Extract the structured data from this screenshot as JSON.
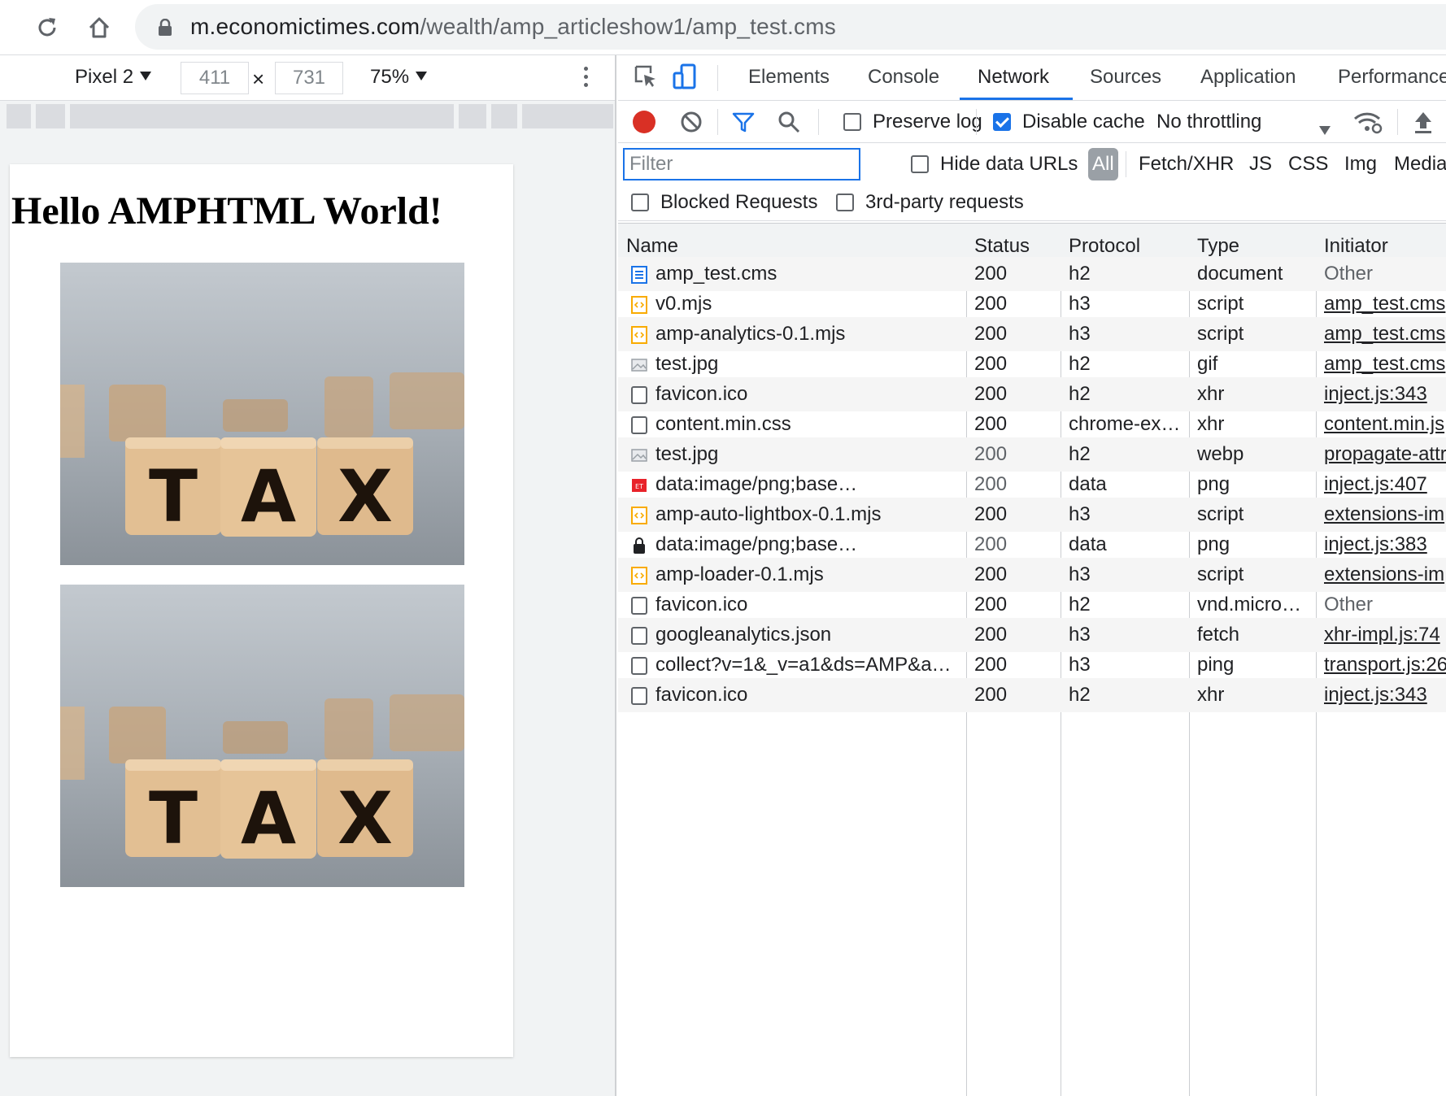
{
  "browser": {
    "url_host": "m.economictimes.com",
    "url_path": "/wealth/amp_articleshow1/amp_test.cms",
    "icons": [
      "reload-icon",
      "home-icon",
      "lock-icon"
    ]
  },
  "device_toolbar": {
    "device": "Pixel 2",
    "width": "411",
    "height": "731",
    "times": "×",
    "zoom": "75%"
  },
  "page": {
    "heading": "Hello AMPHTML World!",
    "image_letters": [
      "T",
      "A",
      "X"
    ]
  },
  "devtools": {
    "tabs": [
      "Elements",
      "Console",
      "Network",
      "Sources",
      "Application",
      "Performance"
    ],
    "active_tab": "Network",
    "toolbar": {
      "preserve_log": "Preserve log",
      "preserve_log_checked": false,
      "disable_cache": "Disable cache",
      "disable_cache_checked": true,
      "throttling": "No throttling"
    },
    "filter": {
      "placeholder": "Filter",
      "hide_data_urls": "Hide data URLs",
      "types": [
        "All",
        "Fetch/XHR",
        "JS",
        "CSS",
        "Img",
        "Media"
      ],
      "blocked_requests": "Blocked Requests",
      "third_party": "3rd-party requests"
    },
    "columns": [
      "Name",
      "Status",
      "Protocol",
      "Type",
      "Initiator"
    ],
    "rows": [
      {
        "icon": "document",
        "name": "amp_test.cms",
        "status": "200",
        "protocol": "h2",
        "type": "document",
        "initiator": "Other",
        "initiator_link": false,
        "status_dim": false
      },
      {
        "icon": "script",
        "name": "v0.mjs",
        "status": "200",
        "protocol": "h3",
        "type": "script",
        "initiator": "amp_test.cms",
        "initiator_link": true,
        "status_dim": false
      },
      {
        "icon": "script",
        "name": "amp-analytics-0.1.mjs",
        "status": "200",
        "protocol": "h3",
        "type": "script",
        "initiator": "amp_test.cms",
        "initiator_link": true,
        "status_dim": false
      },
      {
        "icon": "image",
        "name": "test.jpg",
        "status": "200",
        "protocol": "h2",
        "type": "gif",
        "initiator": "amp_test.cms",
        "initiator_link": true,
        "status_dim": false
      },
      {
        "icon": "blank",
        "name": "favicon.ico",
        "status": "200",
        "protocol": "h2",
        "type": "xhr",
        "initiator": "inject.js:343",
        "initiator_link": true,
        "status_dim": false
      },
      {
        "icon": "blank",
        "name": "content.min.css",
        "status": "200",
        "protocol": "chrome-ex…",
        "type": "xhr",
        "initiator": "content.min.js",
        "initiator_link": true,
        "status_dim": false
      },
      {
        "icon": "image",
        "name": "test.jpg",
        "status": "200",
        "protocol": "h2",
        "type": "webp",
        "initiator": "propagate-attr",
        "initiator_link": true,
        "status_dim": true
      },
      {
        "icon": "et-logo",
        "name": "data:image/png;base…",
        "status": "200",
        "protocol": "data",
        "type": "png",
        "initiator": "inject.js:407",
        "initiator_link": true,
        "status_dim": true
      },
      {
        "icon": "script",
        "name": "amp-auto-lightbox-0.1.mjs",
        "status": "200",
        "protocol": "h3",
        "type": "script",
        "initiator": "extensions-im",
        "initiator_link": true,
        "status_dim": false
      },
      {
        "icon": "lock",
        "name": "data:image/png;base…",
        "status": "200",
        "protocol": "data",
        "type": "png",
        "initiator": "inject.js:383",
        "initiator_link": true,
        "status_dim": true
      },
      {
        "icon": "script",
        "name": "amp-loader-0.1.mjs",
        "status": "200",
        "protocol": "h3",
        "type": "script",
        "initiator": "extensions-im",
        "initiator_link": true,
        "status_dim": false
      },
      {
        "icon": "blank",
        "name": "favicon.ico",
        "status": "200",
        "protocol": "h2",
        "type": "vnd.micro…",
        "initiator": "Other",
        "initiator_link": false,
        "status_dim": false
      },
      {
        "icon": "blank",
        "name": "googleanalytics.json",
        "status": "200",
        "protocol": "h3",
        "type": "fetch",
        "initiator": "xhr-impl.js:74",
        "initiator_link": true,
        "status_dim": false
      },
      {
        "icon": "blank",
        "name": "collect?v=1&_v=a1&ds=AMP&a…",
        "status": "200",
        "protocol": "h3",
        "type": "ping",
        "initiator": "transport.js:26",
        "initiator_link": true,
        "status_dim": false
      },
      {
        "icon": "blank",
        "name": "favicon.ico",
        "status": "200",
        "protocol": "h2",
        "type": "xhr",
        "initiator": "inject.js:343",
        "initiator_link": true,
        "status_dim": false
      }
    ]
  },
  "colors": {
    "accent": "#1a73e8",
    "record": "#d93025",
    "script_icon": "#f9ab00",
    "document_icon": "#1a73e8"
  }
}
